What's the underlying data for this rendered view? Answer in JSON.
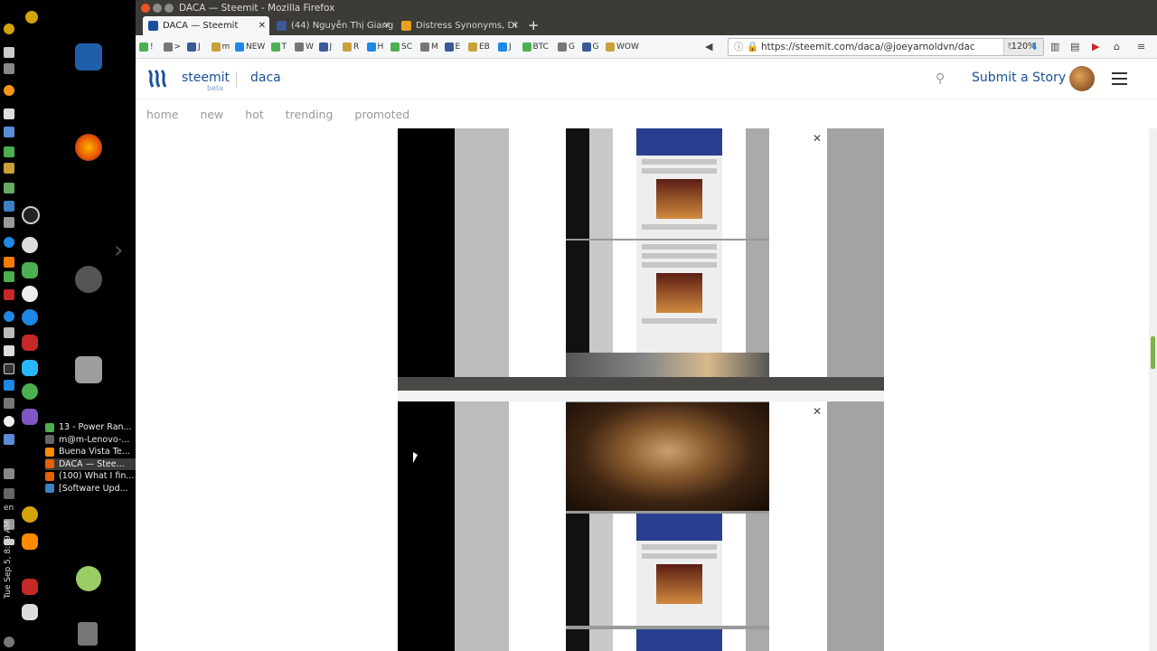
{
  "window": {
    "title": "DACA — Steemit - Mozilla Firefox"
  },
  "tabs": [
    {
      "label": "DACA — Steemit",
      "favicon_color": "#1a5099"
    },
    {
      "label": "(44) Nguyễn Thị Giang",
      "favicon_color": "#3b5998"
    },
    {
      "label": "Distress Synonyms, Di",
      "favicon_color": "#e8a020"
    }
  ],
  "bookmarks": [
    {
      "label": "!"
    },
    {
      "label": ">"
    },
    {
      "label": "J"
    },
    {
      "label": "m"
    },
    {
      "label": "NEW"
    },
    {
      "label": "T"
    },
    {
      "label": "W"
    },
    {
      "label": "J"
    },
    {
      "label": "R"
    },
    {
      "label": "H"
    },
    {
      "label": "SC"
    },
    {
      "label": "M"
    },
    {
      "label": "E"
    },
    {
      "label": "EB"
    },
    {
      "label": "J"
    },
    {
      "label": "BTC"
    },
    {
      "label": "G"
    },
    {
      "label": "G"
    },
    {
      "label": "WOW"
    }
  ],
  "url": {
    "value": "https://steemit.com/daca/@joeyarnoldvn/dac",
    "zoom": "120%"
  },
  "steemit": {
    "brand": "steemit",
    "beta": "beta",
    "tag": "daca",
    "submit": "Submit a Story",
    "nav": [
      "home",
      "new",
      "hot",
      "trending",
      "promoted"
    ]
  },
  "desktop": {
    "clock": "Tue Sep 5, 8:09 AM",
    "lang": "en",
    "tasks": [
      {
        "label": "13 - Power Ran...",
        "color": "#4caf50"
      },
      {
        "label": "m@m-Lenovo-...",
        "color": "#666"
      },
      {
        "label": "Buena Vista Te...",
        "color": "#ff8c00"
      },
      {
        "label": "DACA — Stee...",
        "color": "#e66000"
      },
      {
        "label": "(100) What I fin...",
        "color": "#e66000"
      },
      {
        "label": "[Software Upd...",
        "color": "#3b82c4"
      }
    ]
  },
  "colors": {
    "accent": "#1a5099",
    "titlebar": "#3c3b37"
  }
}
